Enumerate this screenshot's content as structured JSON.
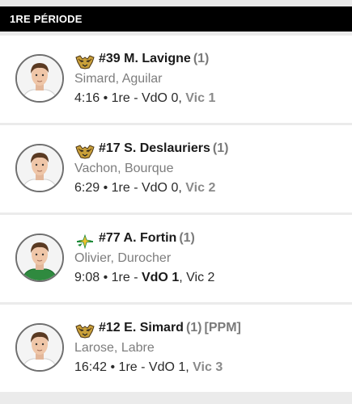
{
  "period": {
    "title": "1RE PÉRIODE"
  },
  "teams": {
    "vic": {
      "logo_icon": "tiger-head-icon",
      "color": "#b08a2a"
    },
    "vdo": {
      "logo_icon": "bird-star-icon",
      "color": "#1f8a3a"
    }
  },
  "goals": [
    {
      "scorer": "#39 M. Lavigne",
      "goal_count": "(1)",
      "tag": "",
      "assists": "Simard, Aguilar",
      "time": "4:16",
      "period": "1re",
      "team_a": "VdO",
      "score_a": "0",
      "team_b": "Vic",
      "score_b": "1",
      "scoring_team": "vic",
      "jersey": "white"
    },
    {
      "scorer": "#17 S. Deslauriers",
      "goal_count": "(1)",
      "tag": "",
      "assists": "Vachon, Bourque",
      "time": "6:29",
      "period": "1re",
      "team_a": "VdO",
      "score_a": "0",
      "team_b": "Vic",
      "score_b": "2",
      "scoring_team": "vic",
      "jersey": "white"
    },
    {
      "scorer": "#77 A. Fortin",
      "goal_count": "(1)",
      "tag": "",
      "assists": "Olivier, Durocher",
      "time": "9:08",
      "period": "1re",
      "team_a": "VdO",
      "score_a": "1",
      "team_b": "Vic",
      "score_b": "2",
      "scoring_team": "vdo",
      "jersey": "green"
    },
    {
      "scorer": "#12 E. Simard",
      "goal_count": "(1)",
      "tag": "[PPM]",
      "assists": "Larose, Labre",
      "time": "16:42",
      "period": "1re",
      "team_a": "VdO",
      "score_a": "1",
      "team_b": "Vic",
      "score_b": "3",
      "scoring_team": "vic",
      "jersey": "white"
    }
  ]
}
